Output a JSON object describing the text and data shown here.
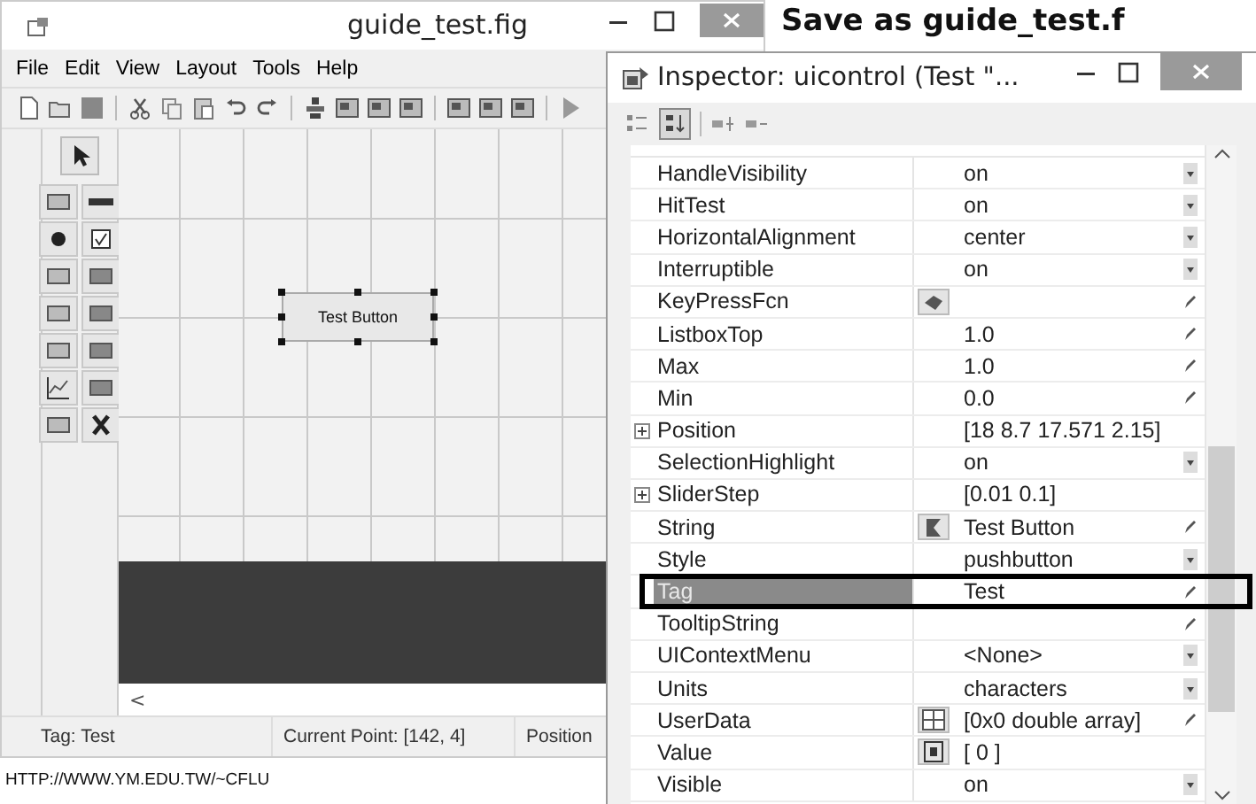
{
  "slide": {
    "title": "Save as guide_test.f",
    "footer": "HTTP://WWW.YM.EDU.TW/~CFLU"
  },
  "guide_window": {
    "title": "guide_test.fig",
    "menu": [
      "File",
      "Edit",
      "View",
      "Layout",
      "Tools",
      "Help"
    ],
    "canvas_button": {
      "label": "Test Button",
      "selected": true
    },
    "scroll_arrow": "<",
    "status_bar": [
      "Tag: Test",
      "Current Point:  [142, 4]",
      "Position"
    ]
  },
  "inspector": {
    "title": "Inspector:  uicontrol (Test \"...",
    "view_toggles": [
      {
        "kind": "categorized",
        "selected": false
      },
      {
        "kind": "alphabetical",
        "selected": true
      }
    ],
    "properties": [
      {
        "name": "HandleVisibility",
        "value": "on",
        "kind": "choice",
        "selected": false
      },
      {
        "name": "HitTest",
        "value": "on",
        "kind": "choice",
        "selected": false
      },
      {
        "name": "HorizontalAlignment",
        "value": "center",
        "kind": "choice",
        "selected": false
      },
      {
        "name": "Interruptible",
        "value": "on",
        "kind": "choice",
        "selected": false
      },
      {
        "name": "KeyPressFcn",
        "kind": "callback",
        "selected": false
      },
      {
        "name": "ListboxTop",
        "value": "1.0",
        "kind": "edit",
        "selected": false
      },
      {
        "name": "Max",
        "value": "1.0",
        "kind": "edit",
        "selected": false
      },
      {
        "name": "Min",
        "value": "0.0",
        "kind": "edit",
        "selected": false
      },
      {
        "name": "Position",
        "value": "[18 8.7 17.571 2.15]",
        "kind": "vector",
        "expanded": false,
        "selected": false
      },
      {
        "name": "SelectionHighlight",
        "value": "on",
        "kind": "choice",
        "selected": false
      },
      {
        "name": "SliderStep",
        "value": "[0.01 0.1]",
        "kind": "vector",
        "expanded": false,
        "selected": false
      },
      {
        "name": "String",
        "value": "Test Button",
        "kind": "string",
        "selected": false
      },
      {
        "name": "Style",
        "value": "pushbutton",
        "kind": "choice",
        "selected": false
      },
      {
        "name": "Tag",
        "value": "Test",
        "kind": "edit",
        "selected": true
      },
      {
        "name": "TooltipString",
        "kind": "edit",
        "selected": false
      },
      {
        "name": "UIContextMenu",
        "value": "<None>",
        "kind": "choice",
        "selected": false
      },
      {
        "name": "Units",
        "value": "characters",
        "kind": "choice",
        "selected": false
      },
      {
        "name": "UserData",
        "value": "[0x0  double array]",
        "kind": "table",
        "selected": false
      },
      {
        "name": "Value",
        "value": "[ 0 ]",
        "kind": "array",
        "selected": false
      },
      {
        "name": "Visible",
        "value": "on",
        "kind": "choice",
        "selected": false
      }
    ]
  }
}
